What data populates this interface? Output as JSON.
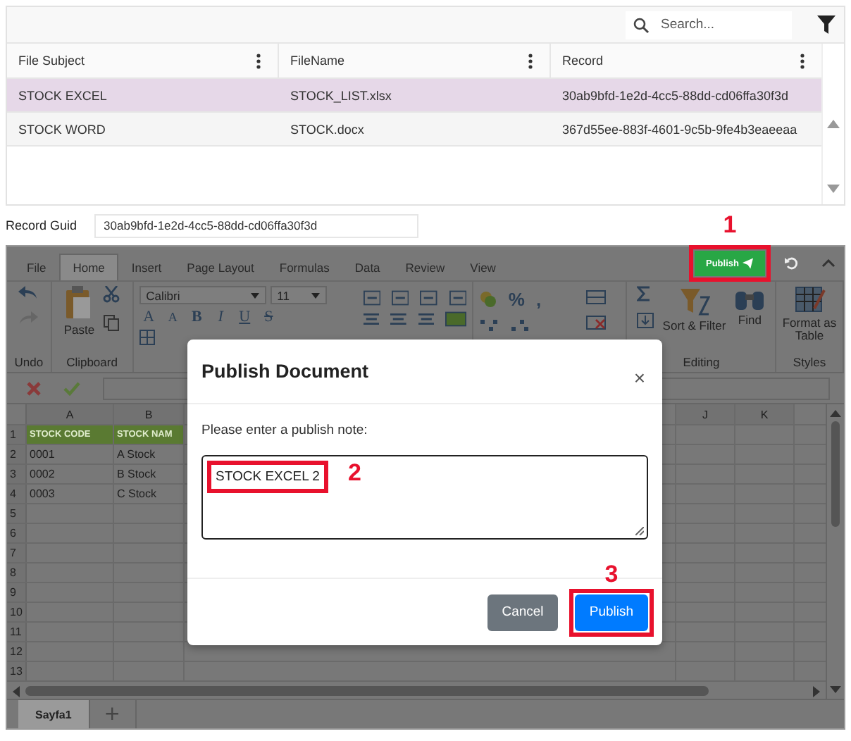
{
  "grid": {
    "search": {
      "placeholder": "Search..."
    },
    "columns": [
      "File Subject",
      "FileName",
      "Record"
    ],
    "rows": [
      {
        "cells": [
          "STOCK EXCEL",
          "STOCK_LIST.xlsx",
          "30ab9bfd-1e2d-4cc5-88dd-cd06ffa30f3d"
        ],
        "selected": true
      },
      {
        "cells": [
          "STOCK WORD",
          "STOCK.docx",
          "367d55ee-883f-4601-9c5b-9fe4b3eaeeaa"
        ],
        "selected": false
      }
    ]
  },
  "record_guid": {
    "label": "Record Guid",
    "value": "30ab9bfd-1e2d-4cc5-88dd-cd06ffa30f3d"
  },
  "spreadsheet": {
    "tabs": [
      {
        "label": "File",
        "selected": false
      },
      {
        "label": "Home",
        "selected": true
      },
      {
        "label": "Insert",
        "selected": false
      },
      {
        "label": "Page Layout",
        "selected": false
      },
      {
        "label": "Formulas",
        "selected": false
      },
      {
        "label": "Data",
        "selected": false
      },
      {
        "label": "Review",
        "selected": false
      },
      {
        "label": "View",
        "selected": false
      }
    ],
    "publish_button": {
      "label": "Publish",
      "callout": "1"
    },
    "ribbon": {
      "paste": "Paste",
      "font": "Calibri",
      "font_size": "11",
      "format_buttons": [
        {
          "label": "A",
          "kind": "grow"
        },
        {
          "label": "A",
          "kind": "shrink"
        },
        {
          "label": "B",
          "kind": "bold"
        },
        {
          "label": "I",
          "kind": "italic"
        },
        {
          "label": "U",
          "kind": "underline"
        },
        {
          "label": "S",
          "kind": "strike"
        }
      ],
      "number_buttons": [
        "%",
        ","
      ],
      "sort_filter": "Sort & Filter",
      "find": "Find",
      "format_table": "Format as Table",
      "group_labels": [
        "Undo",
        "Clipboard",
        "Editing",
        "Styles"
      ]
    },
    "columns_left": [
      "A",
      "B"
    ],
    "columns_right": [
      "J",
      "K"
    ],
    "rows": [
      {
        "number": "1",
        "cells": [
          "STOCK CODE",
          "STOCK NAM"
        ],
        "header": true
      },
      {
        "number": "2",
        "cells": [
          "0001",
          "A Stock"
        ],
        "header": false
      },
      {
        "number": "3",
        "cells": [
          "0002",
          "B Stock"
        ],
        "header": false
      },
      {
        "number": "4",
        "cells": [
          "0003",
          "C Stock"
        ],
        "header": false
      },
      {
        "number": "5",
        "cells": [],
        "header": false
      },
      {
        "number": "6",
        "cells": [],
        "header": false
      },
      {
        "number": "7",
        "cells": [],
        "header": false
      },
      {
        "number": "8",
        "cells": [],
        "header": false
      },
      {
        "number": "9",
        "cells": [],
        "header": false
      },
      {
        "number": "10",
        "cells": [],
        "header": false
      },
      {
        "number": "11",
        "cells": [],
        "header": false
      },
      {
        "number": "12",
        "cells": [],
        "header": false
      },
      {
        "number": "13",
        "cells": [],
        "header": false
      }
    ],
    "sheet_tabs": [
      {
        "label": "Sayfa1",
        "selected": true
      }
    ],
    "add_sheet": "+"
  },
  "dialog": {
    "title": "Publish Document",
    "close": "×",
    "prompt": "Please enter a publish note:",
    "note": {
      "value": "STOCK EXCEL 2",
      "callout": "2"
    },
    "buttons": [
      {
        "label": "Cancel",
        "kind": "secondary"
      },
      {
        "label": "Publish",
        "kind": "primary",
        "callout": "3"
      }
    ]
  }
}
